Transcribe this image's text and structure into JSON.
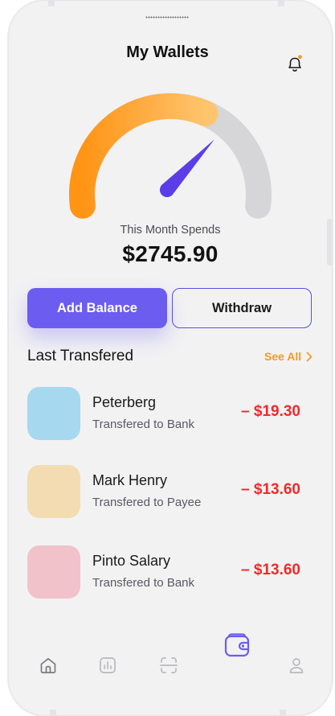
{
  "header": {
    "title": "My Wallets"
  },
  "summary": {
    "label": "This Month Spends",
    "value": "$2745.90",
    "gauge_fill": 0.62
  },
  "actions": {
    "add_balance": "Add Balance",
    "withdraw": "Withdraw"
  },
  "transfers": {
    "title": "Last Transfered",
    "see_all": "See All",
    "items": [
      {
        "name": "Peterberg",
        "detail": "Transfered to Bank",
        "amount": "– $19.30",
        "color": "#a6d8ef"
      },
      {
        "name": "Mark Henry",
        "detail": "Transfered to  Payee",
        "amount": "– $13.60",
        "color": "#f3dcb1"
      },
      {
        "name": "Pinto Salary",
        "detail": "Transfered to Bank",
        "amount": "– $13.60",
        "color": "#f1c2ca"
      }
    ]
  },
  "nav": {
    "items": [
      "home-icon",
      "chart-icon",
      "scan-icon",
      "wallet-icon",
      "profile-icon"
    ],
    "active": "wallet-icon"
  },
  "colors": {
    "accent": "#6c5cf0",
    "gauge_start": "#ff9415",
    "gauge_end": "#ffc46e",
    "gauge_track": "#d6d6d8",
    "negative": "#f02a2a",
    "link": "#f59a24"
  }
}
